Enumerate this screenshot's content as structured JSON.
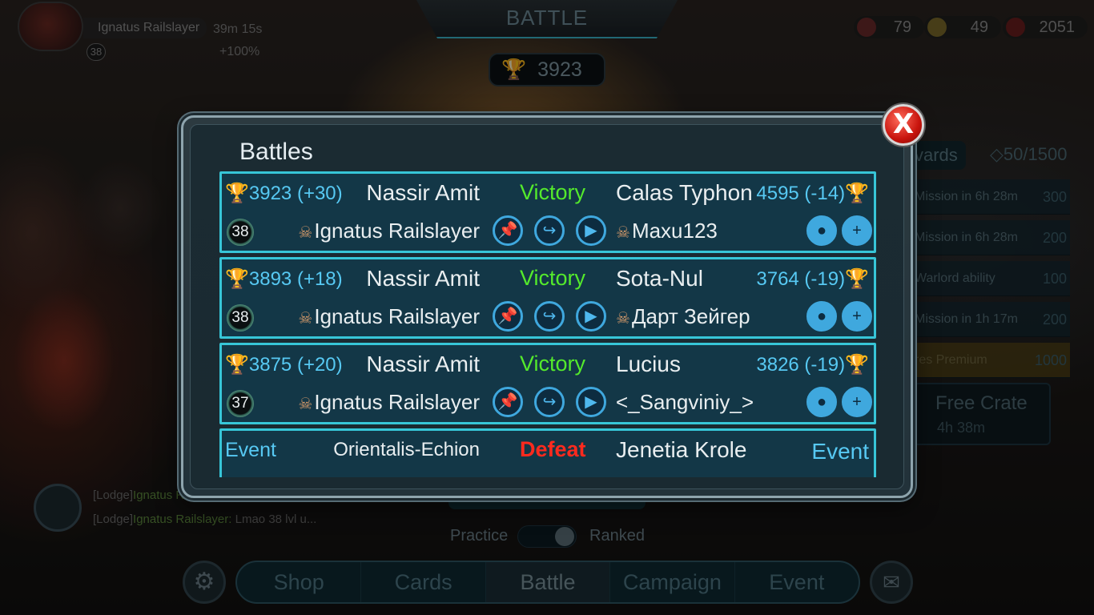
{
  "header": {
    "title": "BATTLE",
    "trophies": "3923",
    "player": {
      "name": "Ignatus Railslayer",
      "level": "38",
      "timer": "39m 15s",
      "bonus": "+100%"
    },
    "currencies": [
      {
        "icon": "cards-icon",
        "value": "79"
      },
      {
        "icon": "coin-icon",
        "value": "49"
      },
      {
        "icon": "gem-icon",
        "value": "2051"
      }
    ]
  },
  "side_panel": {
    "rewards_tab": "vards",
    "rewards_total": "50/1500",
    "missions": [
      {
        "label": "Mission in 6h 28m",
        "points": "300"
      },
      {
        "label": "Mission in 6h 28m",
        "points": "200"
      },
      {
        "label": "Warlord ability",
        "points": "100"
      },
      {
        "label": "Mission in 1h 17m",
        "points": "200"
      },
      {
        "label": "res Premium",
        "points": "1000"
      }
    ],
    "free_crate": {
      "title": "Free Crate",
      "timer": "4h 38m"
    }
  },
  "chat": {
    "lines": [
      {
        "channel": "[Lodge]",
        "name": "Ignatus Ra",
        "text": ""
      },
      {
        "channel": "[Lodge]",
        "name": "Ignatus Railslayer:",
        "text": "Lmao 38 lvl u..."
      }
    ]
  },
  "mode_toggle": {
    "left": "Practice",
    "right": "Ranked"
  },
  "nav": {
    "items": [
      "Shop",
      "Cards",
      "Battle",
      "Campaign",
      "Event"
    ],
    "active": "Battle"
  },
  "modal": {
    "title": "Battles",
    "close_label": "X",
    "battles": [
      {
        "my_trophies": "3923 (+30)",
        "my_name": "Nassir Amit",
        "result": "Victory",
        "opp_name": "Calas Typhon",
        "opp_trophies": "4595 (-14)",
        "my_level": "38",
        "my_user": "Ignatus Railslayer",
        "opp_user": "Maxu123",
        "opp_skull": true
      },
      {
        "my_trophies": "3893 (+18)",
        "my_name": "Nassir Amit",
        "result": "Victory",
        "opp_name": "Sota-Nul",
        "opp_trophies": "3764 (-19)",
        "my_level": "38",
        "my_user": "Ignatus Railslayer",
        "opp_user": "Дарт Зейгер",
        "opp_skull": true
      },
      {
        "my_trophies": "3875 (+20)",
        "my_name": "Nassir Amit",
        "result": "Victory",
        "opp_name": "Lucius",
        "opp_trophies": "3826 (-19)",
        "my_level": "37",
        "my_user": "Ignatus Railslayer",
        "opp_user": "<_Sangviniy_>",
        "opp_skull": false
      },
      {
        "my_trophies": "Event",
        "my_name": "Orientalis-Echion",
        "result": "Defeat",
        "opp_name": "Jenetia Krole",
        "opp_trophies": "Event",
        "my_level": "",
        "my_user": "",
        "opp_user": "",
        "opp_skull": false
      }
    ]
  },
  "colors": {
    "victory": "#54ea2c",
    "defeat": "#ff2a1e",
    "row_border": "#37c6d8",
    "trophy_text": "#57c9f3"
  }
}
